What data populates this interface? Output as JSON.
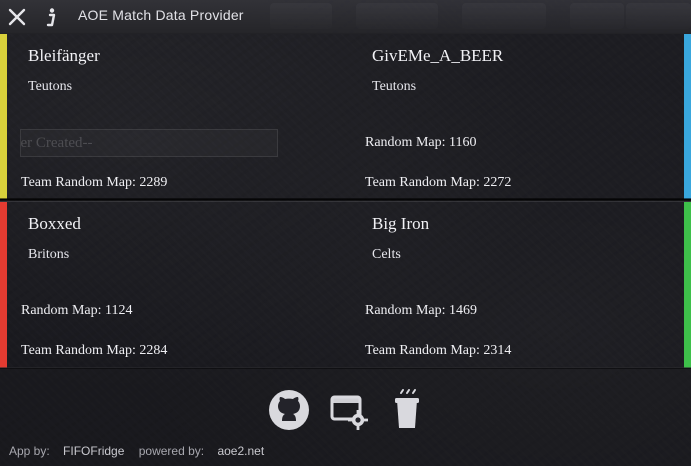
{
  "app": {
    "title": "AOE Match Data Provider"
  },
  "teams": [
    {
      "players": [
        {
          "side": "left",
          "name": "Bleifänger",
          "civ": "Teutons",
          "rm_placeholder": "--ger Created--",
          "trm": "Team Random Map: 2289",
          "color": "#d9d13b"
        },
        {
          "side": "right",
          "name": "GivEMe_A_BEER",
          "civ": "Teutons",
          "rm": "Random Map: 1160",
          "trm": "Team Random Map: 2272",
          "color": "#39a7dd"
        }
      ]
    },
    {
      "players": [
        {
          "side": "left",
          "name": "Boxxed",
          "civ": "Britons",
          "rm": "Random Map: 1124",
          "trm": "Team Random Map: 2284",
          "color": "#e33b31"
        },
        {
          "side": "right",
          "name": "Big Iron",
          "civ": "Celts",
          "rm": "Random Map: 1469",
          "trm": "Team Random Map: 2314",
          "color": "#3ec04a"
        }
      ]
    }
  ],
  "footer": {
    "icons": [
      "github-icon",
      "settings-icon",
      "coffee-icon"
    ],
    "app_by_label": "App by:",
    "app_by_value": "FIFOFridge",
    "powered_by_label": "powered by:",
    "powered_by_value": "aoe2.net"
  },
  "ui": {
    "close_icon": "close-icon",
    "info_icon": "info-icon"
  }
}
